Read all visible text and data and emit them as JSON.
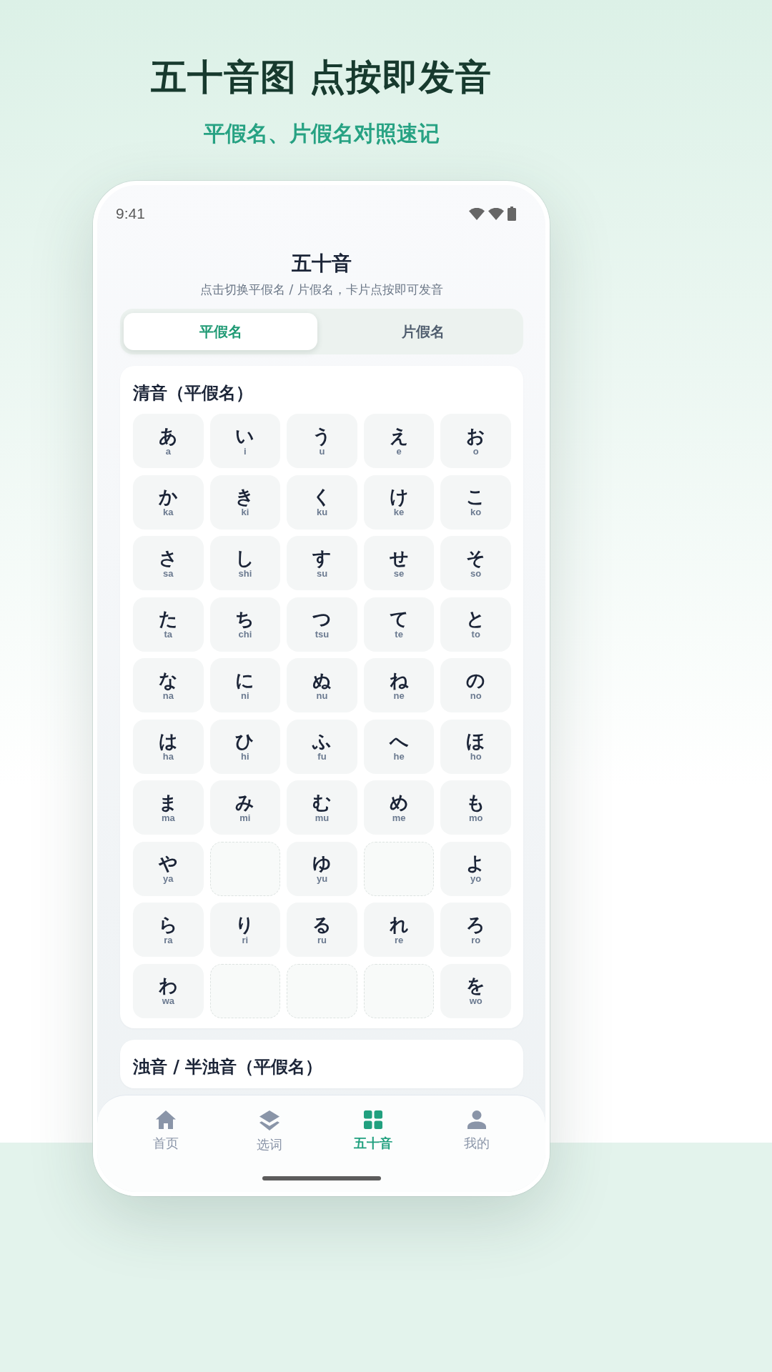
{
  "banner": {
    "title": "五十音图 点按即发音",
    "subtitle": "平假名、片假名对照速记"
  },
  "status_bar": {
    "time": "9:41"
  },
  "screen_header": {
    "title": "五十音",
    "subtitle": "点击切换平假名 / 片假名，卡片点按即可发音"
  },
  "tabs": [
    {
      "label": "平假名",
      "selected": true
    },
    {
      "label": "片假名",
      "selected": false
    }
  ],
  "sections": [
    {
      "title": "清音（平假名）",
      "cells": [
        {
          "kind": "kana",
          "kana": "あ",
          "romaji": "a"
        },
        {
          "kind": "kana",
          "kana": "い",
          "romaji": "i"
        },
        {
          "kind": "kana",
          "kana": "う",
          "romaji": "u"
        },
        {
          "kind": "kana",
          "kana": "え",
          "romaji": "e"
        },
        {
          "kind": "kana",
          "kana": "お",
          "romaji": "o"
        },
        {
          "kind": "kana",
          "kana": "か",
          "romaji": "ka"
        },
        {
          "kind": "kana",
          "kana": "き",
          "romaji": "ki"
        },
        {
          "kind": "kana",
          "kana": "く",
          "romaji": "ku"
        },
        {
          "kind": "kana",
          "kana": "け",
          "romaji": "ke"
        },
        {
          "kind": "kana",
          "kana": "こ",
          "romaji": "ko"
        },
        {
          "kind": "kana",
          "kana": "さ",
          "romaji": "sa"
        },
        {
          "kind": "kana",
          "kana": "し",
          "romaji": "shi"
        },
        {
          "kind": "kana",
          "kana": "す",
          "romaji": "su"
        },
        {
          "kind": "kana",
          "kana": "せ",
          "romaji": "se"
        },
        {
          "kind": "kana",
          "kana": "そ",
          "romaji": "so"
        },
        {
          "kind": "kana",
          "kana": "た",
          "romaji": "ta"
        },
        {
          "kind": "kana",
          "kana": "ち",
          "romaji": "chi"
        },
        {
          "kind": "kana",
          "kana": "つ",
          "romaji": "tsu"
        },
        {
          "kind": "kana",
          "kana": "て",
          "romaji": "te"
        },
        {
          "kind": "kana",
          "kana": "と",
          "romaji": "to"
        },
        {
          "kind": "kana",
          "kana": "な",
          "romaji": "na"
        },
        {
          "kind": "kana",
          "kana": "に",
          "romaji": "ni"
        },
        {
          "kind": "kana",
          "kana": "ぬ",
          "romaji": "nu"
        },
        {
          "kind": "kana",
          "kana": "ね",
          "romaji": "ne"
        },
        {
          "kind": "kana",
          "kana": "の",
          "romaji": "no"
        },
        {
          "kind": "kana",
          "kana": "は",
          "romaji": "ha"
        },
        {
          "kind": "kana",
          "kana": "ひ",
          "romaji": "hi"
        },
        {
          "kind": "kana",
          "kana": "ふ",
          "romaji": "fu"
        },
        {
          "kind": "kana",
          "kana": "へ",
          "romaji": "he"
        },
        {
          "kind": "kana",
          "kana": "ほ",
          "romaji": "ho"
        },
        {
          "kind": "kana",
          "kana": "ま",
          "romaji": "ma"
        },
        {
          "kind": "kana",
          "kana": "み",
          "romaji": "mi"
        },
        {
          "kind": "kana",
          "kana": "む",
          "romaji": "mu"
        },
        {
          "kind": "kana",
          "kana": "め",
          "romaji": "me"
        },
        {
          "kind": "kana",
          "kana": "も",
          "romaji": "mo"
        },
        {
          "kind": "kana",
          "kana": "や",
          "romaji": "ya"
        },
        {
          "kind": "empty"
        },
        {
          "kind": "kana",
          "kana": "ゆ",
          "romaji": "yu"
        },
        {
          "kind": "empty"
        },
        {
          "kind": "kana",
          "kana": "よ",
          "romaji": "yo"
        },
        {
          "kind": "kana",
          "kana": "ら",
          "romaji": "ra"
        },
        {
          "kind": "kana",
          "kana": "り",
          "romaji": "ri"
        },
        {
          "kind": "kana",
          "kana": "る",
          "romaji": "ru"
        },
        {
          "kind": "kana",
          "kana": "れ",
          "romaji": "re"
        },
        {
          "kind": "kana",
          "kana": "ろ",
          "romaji": "ro"
        },
        {
          "kind": "kana",
          "kana": "わ",
          "romaji": "wa"
        },
        {
          "kind": "empty"
        },
        {
          "kind": "empty"
        },
        {
          "kind": "empty"
        },
        {
          "kind": "kana",
          "kana": "を",
          "romaji": "wo"
        }
      ]
    },
    {
      "title": "浊音 / 半浊音（平假名）"
    }
  ],
  "bottom_nav": [
    {
      "label": "首页",
      "selected": false
    },
    {
      "label": "选词",
      "selected": false
    },
    {
      "label": "五十音",
      "selected": true
    },
    {
      "label": "我的",
      "selected": false
    }
  ]
}
